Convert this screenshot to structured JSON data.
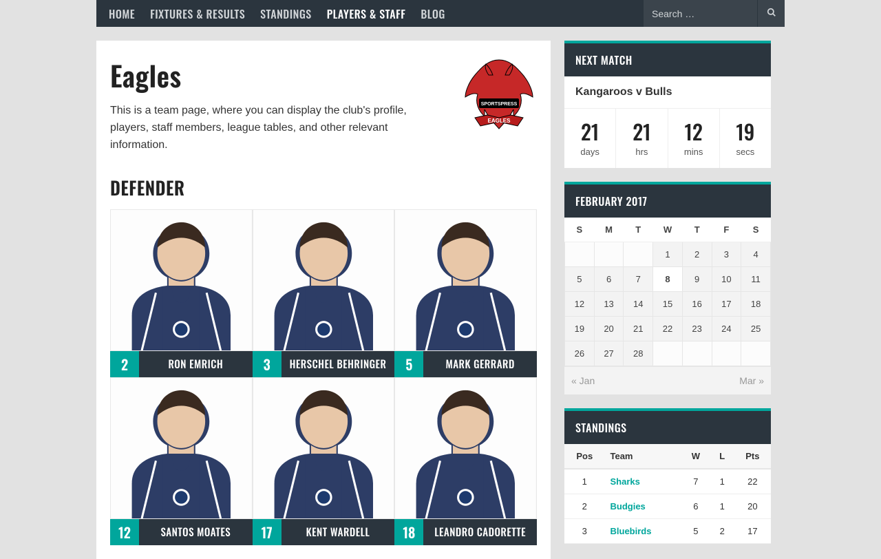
{
  "nav": {
    "items": [
      {
        "label": "HOME",
        "active": false
      },
      {
        "label": "FIXTURES & RESULTS",
        "active": false
      },
      {
        "label": "STANDINGS",
        "active": false
      },
      {
        "label": "PLAYERS & STAFF",
        "active": true
      },
      {
        "label": "BLOG",
        "active": false
      }
    ],
    "search_placeholder": "Search …"
  },
  "team": {
    "title": "Eagles",
    "desc": "This is a team page, where you can display the club's profile, players, staff members, league tables, and other relevant information.",
    "logo_main": "#c62828",
    "logo_band": "#b71c1c",
    "logo_text": "SPORTSPRESS",
    "logo_banner": "EAGLES"
  },
  "sections": [
    {
      "heading": "DEFENDER"
    }
  ],
  "players": [
    {
      "num": "2",
      "name": "RON EMRICH"
    },
    {
      "num": "3",
      "name": "HERSCHEL BEHRINGER"
    },
    {
      "num": "5",
      "name": "MARK GERRARD"
    },
    {
      "num": "12",
      "name": "SANTOS MOATES"
    },
    {
      "num": "17",
      "name": "KENT WARDELL"
    },
    {
      "num": "18",
      "name": "LEANDRO CADORETTE"
    }
  ],
  "player_jersey": "#2d3d66",
  "player_skin": "#e8c7a8",
  "next_match": {
    "heading": "NEXT MATCH",
    "title": "Kangaroos v Bulls",
    "cells": [
      {
        "v": "21",
        "l": "days"
      },
      {
        "v": "21",
        "l": "hrs"
      },
      {
        "v": "12",
        "l": "mins"
      },
      {
        "v": "19",
        "l": "secs"
      }
    ]
  },
  "calendar": {
    "heading": "FEBRUARY 2017",
    "dow": [
      "S",
      "M",
      "T",
      "W",
      "T",
      "F",
      "S"
    ],
    "weeks": [
      [
        "",
        "",
        "",
        "1",
        "2",
        "3",
        "4"
      ],
      [
        "5",
        "6",
        "7",
        "8",
        "9",
        "10",
        "11"
      ],
      [
        "12",
        "13",
        "14",
        "15",
        "16",
        "17",
        "18"
      ],
      [
        "19",
        "20",
        "21",
        "22",
        "23",
        "24",
        "25"
      ],
      [
        "26",
        "27",
        "28",
        "",
        "",
        "",
        ""
      ]
    ],
    "today": "8",
    "prev": "« Jan",
    "next": "Mar »"
  },
  "standings": {
    "heading": "STANDINGS",
    "cols": [
      "Pos",
      "Team",
      "W",
      "L",
      "Pts"
    ],
    "rows": [
      {
        "pos": "1",
        "team": "Sharks",
        "w": "7",
        "l": "1",
        "pts": "22"
      },
      {
        "pos": "2",
        "team": "Budgies",
        "w": "6",
        "l": "1",
        "pts": "20"
      },
      {
        "pos": "3",
        "team": "Bluebirds",
        "w": "5",
        "l": "2",
        "pts": "17"
      }
    ]
  }
}
